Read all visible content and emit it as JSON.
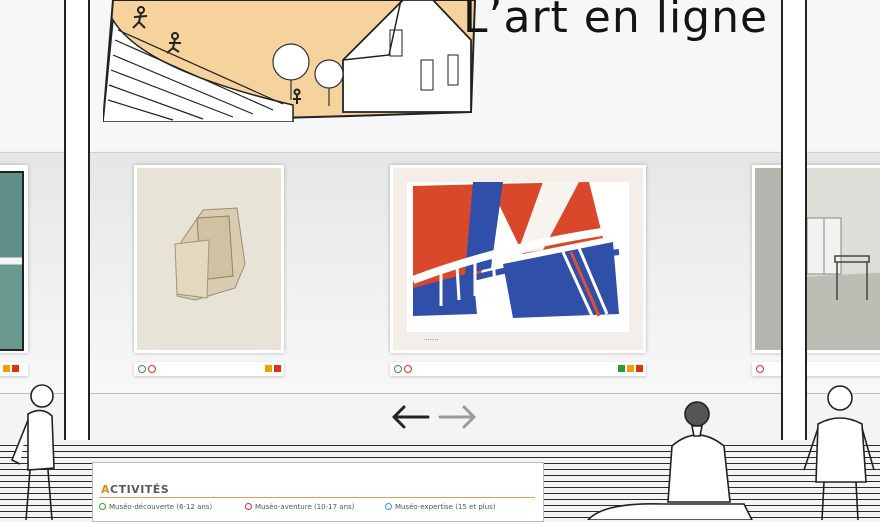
{
  "header": {
    "title": "L’art en ligne"
  },
  "artworks": [
    {
      "id": "partial-left",
      "status_dots": [],
      "status_squares": [
        "#f0a000",
        "#e03010"
      ]
    },
    {
      "id": "paper-collage",
      "status_dots": [
        "#2aa02a",
        "#d03030"
      ],
      "status_squares": [
        "#f0a000",
        "#e03010"
      ]
    },
    {
      "id": "red-blue-print",
      "status_dots": [
        "#2aa02a",
        "#d03030"
      ],
      "status_squares": [
        "#2aa02a",
        "#f0a000",
        "#e03010"
      ]
    },
    {
      "id": "room-photo",
      "status_dots": [
        "#d03030"
      ],
      "status_squares": []
    }
  ],
  "nav": {
    "prev_icon": "arrow-left-icon",
    "next_icon": "arrow-right-icon"
  },
  "activities": {
    "title_first": "A",
    "title_rest": "CTIVITÉS",
    "items": [
      {
        "label": "Muséo-découverte (6-12 ans)",
        "color": "#2aa02a"
      },
      {
        "label": "Muséo-aventure (10-17 ans)",
        "color": "#d03030"
      },
      {
        "label": "Muséo-expertise (15 et plus)",
        "color": "#2a9fd6"
      }
    ]
  },
  "colors": {
    "accent": "#e0861f"
  }
}
